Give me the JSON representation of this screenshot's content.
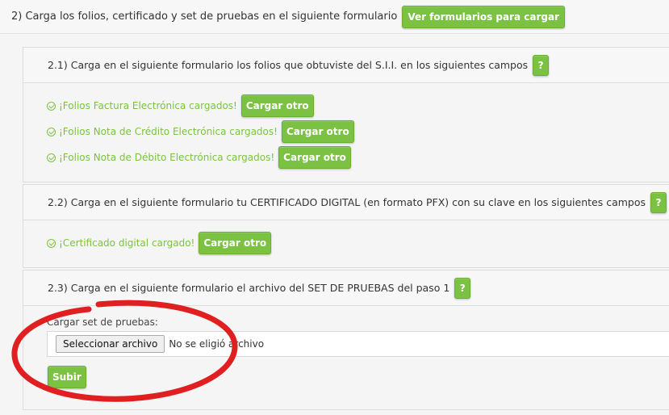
{
  "step2": {
    "title": "2) Carga los folios, certificado y set de pruebas en el siguiente formulario",
    "view_forms_button": "Ver formularios para cargar"
  },
  "section21": {
    "title": "2.1) Carga en el siguiente formulario los folios que obtuviste del S.I.I. en los siguientes campos",
    "help": "?",
    "items": [
      {
        "status": "¡Folios Factura Electrónica cargados!",
        "button": "Cargar otro"
      },
      {
        "status": "¡Folios Nota de Crédito Electrónica cargados!",
        "button": "Cargar otro"
      },
      {
        "status": "¡Folios Nota de Débito Electrónica cargados!",
        "button": "Cargar otro"
      }
    ]
  },
  "section22": {
    "title": "2.2) Carga en el siguiente formulario tu CERTIFICADO DIGITAL (en formato PFX) con su clave en los siguientes campos",
    "help": "?",
    "status": "¡Certificado digital cargado!",
    "button": "Cargar otro"
  },
  "section23": {
    "title": "2.3) Carga en el siguiente formulario el archivo del SET DE PRUEBAS del paso 1",
    "help": "?",
    "upload_label": "Cargar set de pruebas:",
    "file_button": "Seleccionar archivo",
    "file_status": "No se eligió archivo",
    "submit": "Subir"
  },
  "colors": {
    "accent_green": "#7cc242",
    "annotation_red": "#e02020"
  },
  "icons": {
    "status": "check-circle-icon"
  }
}
